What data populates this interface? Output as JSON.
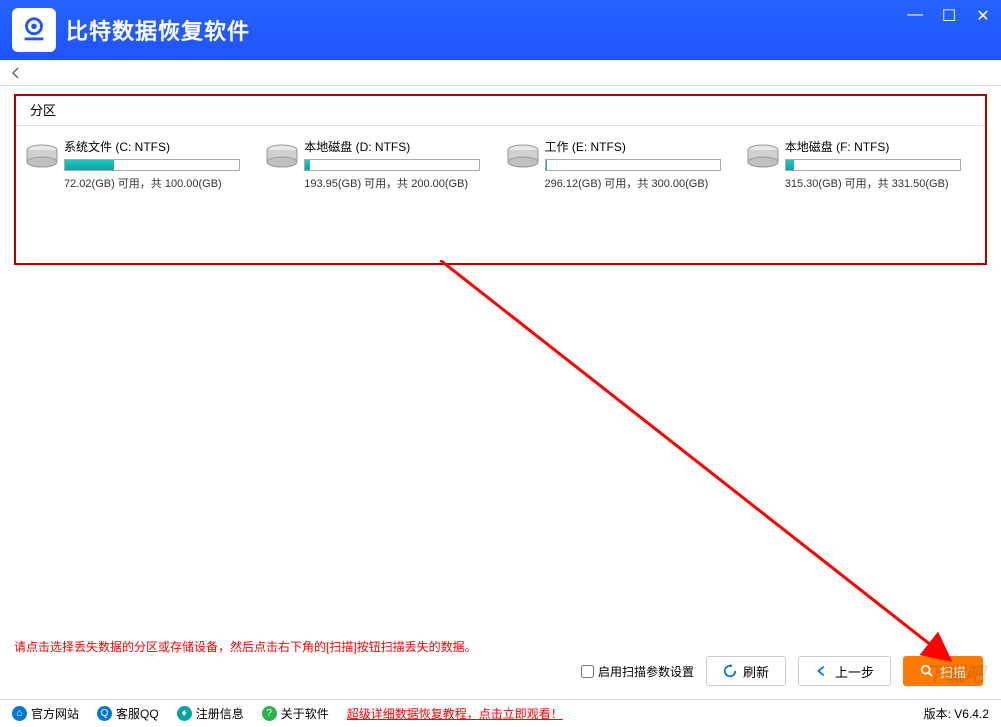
{
  "titlebar": {
    "app_title": "比特数据恢复软件"
  },
  "partition": {
    "header": "分区",
    "drives": [
      {
        "name": "系统文件 (C: NTFS)",
        "free": "72.02",
        "total": "100.00",
        "used_pct": 28
      },
      {
        "name": "本地磁盘 (D: NTFS)",
        "free": "193.95",
        "total": "200.00",
        "used_pct": 3
      },
      {
        "name": "工作 (E: NTFS)",
        "free": "296.12",
        "total": "300.00",
        "used_pct": 1
      },
      {
        "name": "本地磁盘 (F: NTFS)",
        "free": "315.30",
        "total": "331.50",
        "used_pct": 5
      }
    ]
  },
  "hint": "请点击选择丢失数据的分区或存储设备，然后点击右下角的[扫描]按钮扫描丢失的数据。",
  "controls": {
    "checkbox_label": "启用扫描参数设置",
    "refresh": "刷新",
    "prev": "上一步",
    "scan": "扫描"
  },
  "footer": {
    "link1": "官方网站",
    "link2": "客服QQ",
    "link3": "注册信息",
    "link4": "关于软件",
    "tutorial": "超级详细数据恢复教程，点击立即观看！",
    "version": "版本: V6.4.2"
  },
  "labels": {
    "free_unit": "(GB) 可用，共 ",
    "total_unit": "(GB)"
  }
}
